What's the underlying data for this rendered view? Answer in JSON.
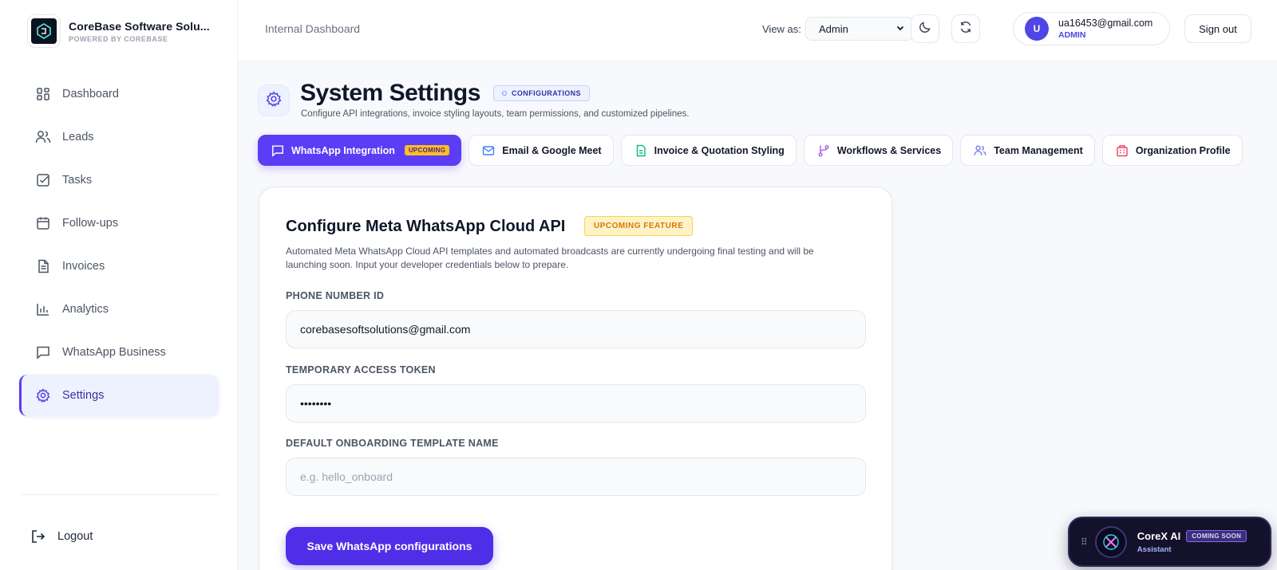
{
  "brand": {
    "name": "CoreBase Software Solu...",
    "sub": "POWERED BY COREBASE"
  },
  "nav": {
    "items": [
      {
        "label": "Dashboard",
        "icon": "grid-icon"
      },
      {
        "label": "Leads",
        "icon": "users-icon"
      },
      {
        "label": "Tasks",
        "icon": "checkbox-icon"
      },
      {
        "label": "Follow-ups",
        "icon": "calendar-icon"
      },
      {
        "label": "Invoices",
        "icon": "document-icon"
      },
      {
        "label": "Analytics",
        "icon": "bar-chart-icon"
      },
      {
        "label": "WhatsApp Business",
        "icon": "message-icon"
      },
      {
        "label": "Settings",
        "icon": "gear-icon",
        "active": true
      }
    ],
    "logout": "Logout"
  },
  "header": {
    "title": "Internal Dashboard",
    "view_as_label": "View as:",
    "view_as_value": "Admin",
    "user_initial": "U",
    "user_email": "ua16453@gmail.com",
    "user_role": "ADMIN",
    "sign_out": "Sign out"
  },
  "page": {
    "title": "System Settings",
    "badge": "CONFIGURATIONS",
    "subtitle": "Configure API integrations, invoice styling layouts, team permissions, and customized pipelines."
  },
  "tabs": [
    {
      "label": "WhatsApp Integration",
      "badge": "UPCOMING",
      "active": true,
      "icon": "message-icon"
    },
    {
      "label": "Email & Google Meet",
      "icon": "mail-icon"
    },
    {
      "label": "Invoice & Quotation Styling",
      "icon": "file-icon"
    },
    {
      "label": "Workflows & Services",
      "icon": "branch-icon"
    },
    {
      "label": "Team Management",
      "icon": "team-icon"
    },
    {
      "label": "Organization Profile",
      "icon": "building-icon"
    }
  ],
  "card": {
    "title": "Configure Meta WhatsApp Cloud API",
    "badge": "UPCOMING FEATURE",
    "description": "Automated Meta WhatsApp Cloud API templates and automated broadcasts are currently undergoing final testing and will be launching soon. Input your developer credentials below to prepare.",
    "fields": [
      {
        "label": "PHONE NUMBER ID",
        "value": "corebasesoftsolutions@gmail.com",
        "placeholder": ""
      },
      {
        "label": "TEMPORARY ACCESS TOKEN",
        "value": "••••••••",
        "placeholder": ""
      },
      {
        "label": "DEFAULT ONBOARDING TEMPLATE NAME",
        "value": "",
        "placeholder": "e.g. hello_onboard"
      }
    ],
    "save_button": "Save WhatsApp configurations"
  },
  "assistant": {
    "name": "CoreX AI",
    "badge": "COMING SOON",
    "sub": "Assistant"
  },
  "colors": {
    "accent": "#5b3df6",
    "warning": "#d97706",
    "sidebar_active_bg": "#eef2ff"
  }
}
